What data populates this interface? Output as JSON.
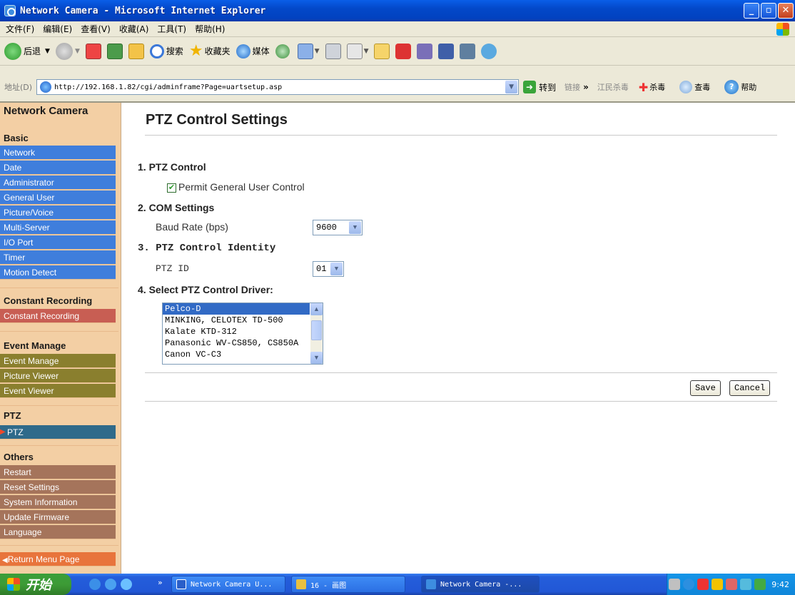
{
  "window": {
    "title": "Network Camera - Microsoft Internet Explorer"
  },
  "menu": [
    "文件(F)",
    "编辑(E)",
    "查看(V)",
    "收藏(A)",
    "工具(T)",
    "帮助(H)"
  ],
  "toolbar": {
    "back": "后退",
    "search": "搜索",
    "favorites": "收藏夹",
    "media": "媒体"
  },
  "address": {
    "label": "地址(D)",
    "url": "http://192.168.1.82/cgi/adminframe?Page=uartsetup.asp",
    "go": "转到",
    "links": "链接",
    "more": "»",
    "jiangmin": "江民杀毒",
    "kill": "杀毒",
    "check": "查毒",
    "help": "帮助"
  },
  "sidebar": {
    "brand": "Network Camera",
    "basic": {
      "title": "Basic",
      "items": [
        "Network",
        "Date",
        "Administrator",
        "General User",
        "Picture/Voice",
        "Multi-Server",
        "I/O Port",
        "Timer",
        "Motion Detect"
      ]
    },
    "recording": {
      "title": "Constant Recording",
      "items": [
        "Constant Recording"
      ]
    },
    "event": {
      "title": "Event Manage",
      "items": [
        "Event Manage",
        "Picture Viewer",
        "Event Viewer"
      ]
    },
    "ptz": {
      "title": "PTZ",
      "items": [
        "PTZ"
      ]
    },
    "others": {
      "title": "Others",
      "items": [
        "Restart",
        "Reset Settings",
        "System Information",
        "Update Firmware",
        "Language"
      ]
    },
    "return": "Return Menu Page"
  },
  "main": {
    "title": "PTZ Control Settings",
    "s1": {
      "heading": "1. PTZ Control",
      "checkbox_label": "Permit General User Control",
      "checked": true
    },
    "s2": {
      "heading": "2. COM Settings",
      "label": "Baud Rate (bps)",
      "value": "9600"
    },
    "s3": {
      "heading": "3. PTZ Control Identity",
      "label": "PTZ ID",
      "value": "01"
    },
    "s4": {
      "heading": "4. Select PTZ Control Driver:",
      "options": [
        "Pelco-D",
        "MINKING, CELOTEX TD-500",
        "Kalate KTD-312",
        "Panasonic WV-CS850, CS850A",
        "Canon VC-C3"
      ],
      "selected": "Pelco-D"
    },
    "save": "Save",
    "cancel": "Cancel"
  },
  "taskbar": {
    "start": "开始",
    "tasks": [
      "Network Camera U...",
      "16 - 画图",
      "Network Camera -..."
    ],
    "time": "9:42"
  }
}
